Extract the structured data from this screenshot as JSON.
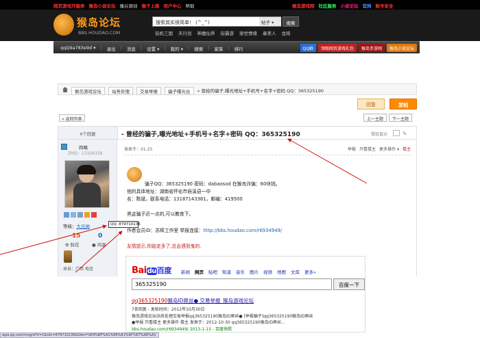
{
  "topbar": {
    "left": [
      {
        "label": "网页游戏开服表",
        "color": "red"
      },
      {
        "label": "猴岛小说论坛",
        "color": "red"
      },
      {
        "label": "播谷源创",
        "color": "white"
      },
      {
        "label": "猴子上路",
        "color": "red"
      },
      {
        "label": "用户中心",
        "color": "red"
      },
      {
        "label": "帮助",
        "color": "white"
      }
    ],
    "right": [
      {
        "label": "猴岛游戏网",
        "color": "red"
      },
      {
        "label": "社区服务",
        "color": "green"
      },
      {
        "label": "小说论坛",
        "color": "pink"
      },
      {
        "label": "官网",
        "color": "blue"
      },
      {
        "label": "账号安全",
        "color": "red"
      }
    ]
  },
  "header": {
    "logo_title": "猴岛论坛",
    "logo_sub": "BBS.HOUDAO.COM",
    "search_placeholder": "搜索其实很简单！ (^_^)",
    "search_type": "帖子 ▾",
    "search_button": "搜索",
    "quicklinks": [
      "街机三国",
      "天行剑",
      "神魔仙界",
      "街霸游",
      "梁世情缘",
      "秦美人",
      "龙将"
    ]
  },
  "navbar": {
    "links": [
      "qqQ9a783e9d ▾",
      "退出",
      "消息",
      "设置 ▾",
      "我的 ▾",
      "搜索",
      "家族",
      "排行"
    ],
    "buttons": [
      {
        "label": "QQ群",
        "style": "blue"
      },
      {
        "label": "领取网页游戏礼包",
        "style": "red"
      },
      {
        "label": "猴岛手游网",
        "style": "red2"
      },
      {
        "label": "猴岛小说论坛",
        "style": "orange"
      }
    ]
  },
  "breadcrumb": {
    "items": [
      "猴岛游戏论坛",
      "站务处理",
      "交易举报",
      "骗子曝光台"
    ],
    "current": "» 曾经的骗子,曝光地址+手机号+名字+密码 QQ：365325190"
  },
  "actions": {
    "reply": "回复",
    "post": "发帖",
    "back": "« 返回列表",
    "prev": "上一主题",
    "next": "下一主题"
  },
  "thread": {
    "reply_count": "4个回复",
    "title": "- 曾经的骗子,曝光地址+手机号+名字+密码 QQ：365325190",
    "view_toggle": "楼层直达"
  },
  "user": {
    "name": "四略",
    "uid": "ZMD：13326339",
    "grade_label": "等级：",
    "grade": "大元帅",
    "stat1_value": "15",
    "stat1_label": "鲜花",
    "stat2_value": "0",
    "stat2_label": "鸡蛋",
    "from": "来自：广西 电信",
    "qq_tip": "QQ: 879710136"
  },
  "post": {
    "meta": "发表于：01-25",
    "tools": [
      "举报",
      "只看楼主",
      "更多操作 ▾"
    ],
    "owner_tag": "楼主",
    "line1": "骗子QQ：365325190  密码：dabaosod  在猴岛诈骗：60块钱。",
    "line2": "他的具体地址：湖南省怀化市辰溪县一中",
    "line3": "名：陈斌，联系电话：13187143381，邮编：419500",
    "line4": "黑这骗子近一点的,可以教育下。",
    "line5_prefix": "作者会员ID：苏辉工作室   举报连接：",
    "line5_link": "http://bbs.houdao.com/r6934949/",
    "warning": "友情提示,你路走多了,总会遇到鬼的."
  },
  "baidu": {
    "logo_bai": "Bai",
    "logo_du": "du",
    "logo_cn": "百度",
    "tabs": [
      "新闻",
      "网页",
      "贴吧",
      "知道",
      "音乐",
      "图片",
      "视频",
      "地图",
      "文库",
      "更多»"
    ],
    "active_tab": "网页",
    "query": "365325190",
    "button": "百度一下",
    "result_title_em": "qq365325190",
    "result_title_rest": "猴岛ID屌丝● 交易举报_猴岛游戏论坛",
    "result_line1": "7条回复 - 发帖时间：2012年10月30日",
    "result_line2": "猴岛游戏论坛站务处理交易举报qq365325190猴岛ID屌丝● [举报骗子]qq365325190猴岛ID屌丝",
    "result_line3": "●举报  只看楼主  更多操作  楼主  发表于：2012-10-30 qq365325190猴岛ID屌丝...",
    "result_url": "bbs.houdao.com/r6934949/ 2013-1-13 - 百度快照"
  },
  "statusbar": "wpa.qq.com/msgrd?V=1&Uin=879710136&Site=%E4%BF%A1%E6%81%AF%E7%AE%A1"
}
